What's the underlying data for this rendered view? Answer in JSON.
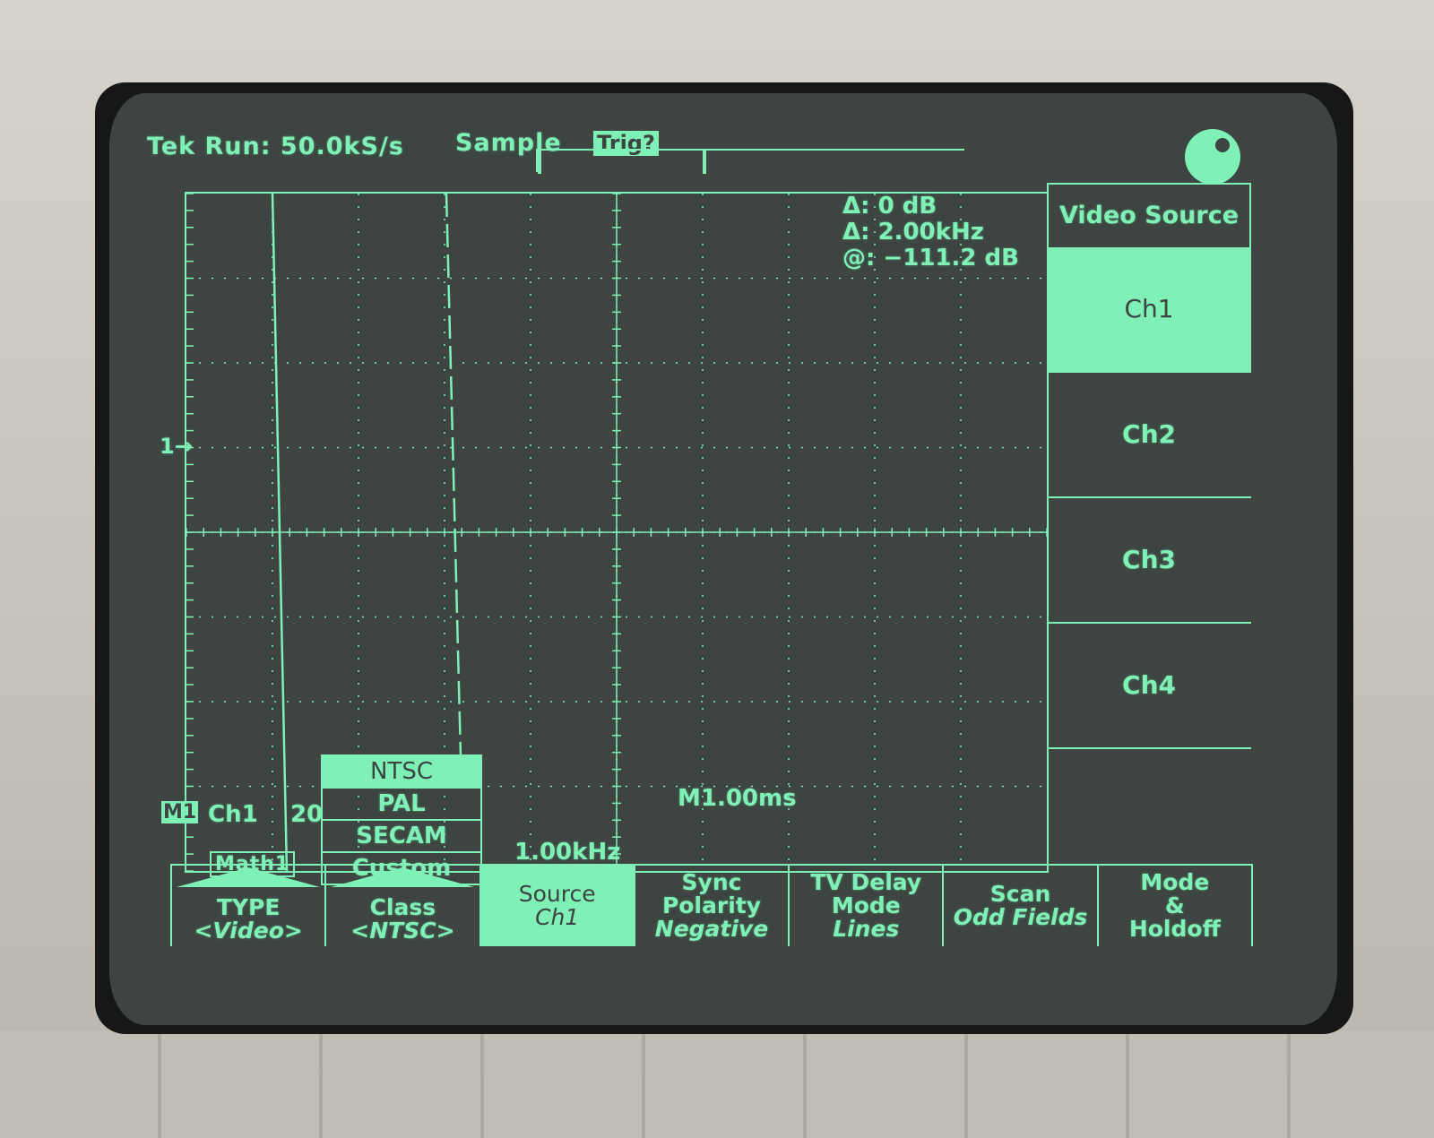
{
  "status": {
    "run": "Tek Run: 50.0kS/s",
    "acq_mode": "Sample",
    "trigger": "Trig?"
  },
  "measurements": {
    "delta_db": "Δ: 0 dB",
    "delta_freq": "Δ: 2.00kHz",
    "at_level": "@: −111.2 dB"
  },
  "waveform": {
    "ch_marker": "1→",
    "math_label": "M1",
    "ch_label": "Ch1",
    "scale": "20",
    "math_name": "Math1",
    "freq": "1.00kHz",
    "timebase": "M1.00ms"
  },
  "popup": {
    "options": [
      "NTSC",
      "PAL",
      "SECAM",
      "Custom"
    ],
    "selected": "NTSC"
  },
  "side_menu": {
    "title": "Video Source",
    "items": [
      "Ch1",
      "Ch2",
      "Ch3",
      "Ch4"
    ],
    "selected": "Ch1"
  },
  "bottom_menu": [
    {
      "line1": "TYPE",
      "line2": "<Video>"
    },
    {
      "line1": "Class",
      "line2": "<NTSC>"
    },
    {
      "line1": "Source",
      "line2": "Ch1"
    },
    {
      "line1": "Sync",
      "line2": "Polarity",
      "line3": "Negative"
    },
    {
      "line1": "TV Delay",
      "line2": "Mode",
      "line3": "Lines"
    },
    {
      "line1": "Scan",
      "line2": "Odd Fields"
    },
    {
      "line1": "Mode",
      "line2": "&",
      "line3": "Holdoff"
    }
  ],
  "colors": {
    "phosphor": "#7ff0b6",
    "screen_bg": "#3d4441"
  }
}
